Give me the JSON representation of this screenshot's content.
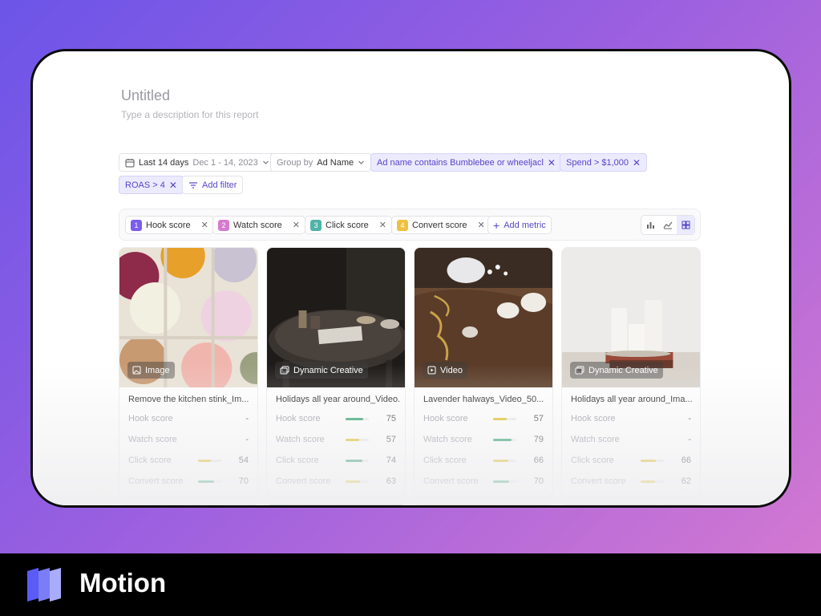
{
  "report": {
    "title": "Untitled",
    "description": "Type a description for this report"
  },
  "filters": {
    "date_label": "Last 14 days",
    "date_range": "Dec 1 - 14, 2023",
    "group_prefix": "Group by",
    "group_value": "Ad Name",
    "active": [
      {
        "label": "Ad name contains Bumblebee or wheeljacl"
      },
      {
        "label": "Spend > $1,000"
      },
      {
        "label": "ROAS > 4"
      }
    ],
    "add_filter": "Add filter"
  },
  "metrics": [
    {
      "index": "1",
      "label": "Hook score",
      "color": "#7b5cf0"
    },
    {
      "index": "2",
      "label": "Watch score",
      "color": "#d67ad0"
    },
    {
      "index": "3",
      "label": "Click score",
      "color": "#4fb3a8"
    },
    {
      "index": "4",
      "label": "Convert score",
      "color": "#f0c040"
    }
  ],
  "add_metric": "Add metric",
  "score_labels": [
    "Hook score",
    "Watch score",
    "Click score",
    "Convert score"
  ],
  "colors": {
    "accent": "#5546c9",
    "good": "#2e9e6a",
    "mid": "#e0c020"
  },
  "cards": [
    {
      "type": "Image",
      "type_icon": "image-icon",
      "name": "Remove the kitchen stink_Im...",
      "scores": [
        {
          "value": "-",
          "pct": null,
          "color": ""
        },
        {
          "value": "-",
          "pct": null,
          "color": ""
        },
        {
          "value": "54",
          "pct": 0.54,
          "color": "#e0c020"
        },
        {
          "value": "70",
          "pct": 0.7,
          "color": "#2e9e6a"
        }
      ]
    },
    {
      "type": "Dynamic Creative",
      "type_icon": "gallery-icon",
      "name": "Holidays all year around_Video...",
      "scores": [
        {
          "value": "75",
          "pct": 0.75,
          "color": "#2e9e6a"
        },
        {
          "value": "57",
          "pct": 0.57,
          "color": "#e0c020"
        },
        {
          "value": "74",
          "pct": 0.74,
          "color": "#2e9e6a"
        },
        {
          "value": "63",
          "pct": 0.63,
          "color": "#e0c020"
        }
      ]
    },
    {
      "type": "Video",
      "type_icon": "play-icon",
      "name": "Lavender halways_Video_50...",
      "scores": [
        {
          "value": "57",
          "pct": 0.57,
          "color": "#e0c020"
        },
        {
          "value": "79",
          "pct": 0.79,
          "color": "#2e9e6a"
        },
        {
          "value": "66",
          "pct": 0.66,
          "color": "#e0c020"
        },
        {
          "value": "70",
          "pct": 0.7,
          "color": "#2e9e6a"
        }
      ]
    },
    {
      "type": "Dynamic Creative",
      "type_icon": "gallery-icon",
      "name": "Holidays all year around_Ima...",
      "scores": [
        {
          "value": "-",
          "pct": null,
          "color": ""
        },
        {
          "value": "-",
          "pct": null,
          "color": ""
        },
        {
          "value": "66",
          "pct": 0.66,
          "color": "#e0c020"
        },
        {
          "value": "62",
          "pct": 0.62,
          "color": "#e0c020"
        }
      ]
    }
  ],
  "footer": {
    "brand": "Motion"
  }
}
